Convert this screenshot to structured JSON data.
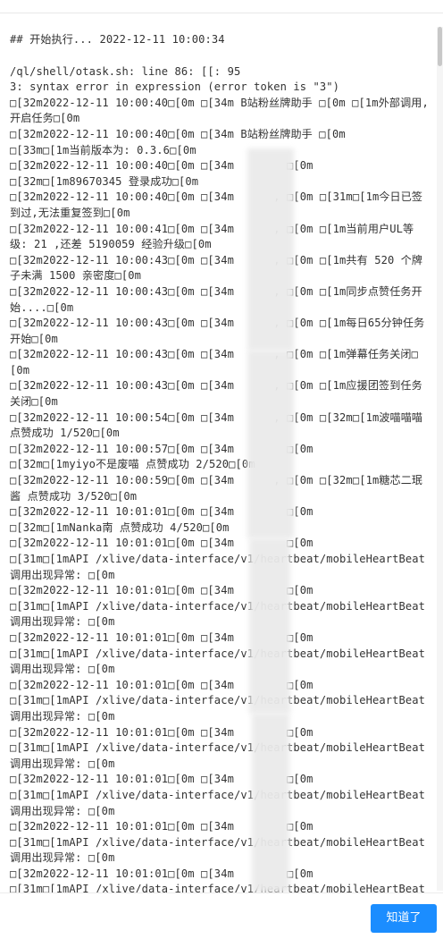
{
  "log": {
    "heading": "## 开始执行... 2022-12-11 10:00:34",
    "lines": [
      "/ql/shell/otask.sh: line 86: [[: 95",
      "3: syntax error in expression (error token is \"3\")",
      "\u001b[32m2022-12-11 10:00:40\u001b[0m \u001b[34m B站粉丝牌助手 \u001b[0m \u001b[1m外部调用,开启任务\u001b[0m",
      "\u001b[32m2022-12-11 10:00:40\u001b[0m \u001b[34m B站粉丝牌助手 \u001b[0m",
      "\u001b[33m\u001b[1m当前版本为: 0.3.6\u001b[0m",
      "\u001b[32m2022-12-11 10:00:40\u001b[0m \u001b[34m        \u001b[0m",
      "\u001b[32m\u001b[1m89670345 登录成功\u001b[0m",
      "\u001b[32m2022-12-11 10:00:40\u001b[0m \u001b[34m      , \u001b[0m \u001b[31m\u001b[1m今日已签到过,无法重复签到\u001b[0m",
      "\u001b[32m2022-12-11 10:00:41\u001b[0m \u001b[34m      , \u001b[0m \u001b[1m当前用户UL等级: 21 ,还差 5190059 经验升级\u001b[0m",
      "\u001b[32m2022-12-11 10:00:43\u001b[0m \u001b[34m      , \u001b[0m \u001b[1m共有 520 个牌子未满 1500 亲密度\u001b[0m",
      "\u001b[32m2022-12-11 10:00:43\u001b[0m \u001b[34m      , \u001b[0m \u001b[1m同步点赞任务开始....\u001b[0m",
      "\u001b[32m2022-12-11 10:00:43\u001b[0m \u001b[34m      , \u001b[0m \u001b[1m每日65分钟任务开始\u001b[0m",
      "\u001b[32m2022-12-11 10:00:43\u001b[0m \u001b[34m      , \u001b[0m \u001b[1m弹幕任务关闭\u001b[0m",
      "\u001b[32m2022-12-11 10:00:43\u001b[0m \u001b[34m      , \u001b[0m \u001b[1m应援团签到任务关闭\u001b[0m",
      "\u001b[32m2022-12-11 10:00:54\u001b[0m \u001b[34m      , \u001b[0m \u001b[32m\u001b[1m波喵喵喵 点赞成功 1/520\u001b[0m",
      "\u001b[32m2022-12-11 10:00:57\u001b[0m \u001b[34m        \u001b[0m",
      "\u001b[32m\u001b[1myiyo不是废喵 点赞成功 2/520\u001b[0m",
      "\u001b[32m2022-12-11 10:00:59\u001b[0m \u001b[34m      , \u001b[0m \u001b[32m\u001b[1m糖芯二珉酱 点赞成功 3/520\u001b[0m",
      "\u001b[32m2022-12-11 10:01:01\u001b[0m \u001b[34m        \u001b[0m",
      "\u001b[32m\u001b[1mNanka南 点赞成功 4/520\u001b[0m",
      "\u001b[32m2022-12-11 10:01:01\u001b[0m \u001b[34m        \u001b[0m",
      "\u001b[31m\u001b[1mAPI /xlive/data-interface/v1/heartbeat/mobileHeartBeat调用出现异常: \u001b[0m",
      "\u001b[32m2022-12-11 10:01:01\u001b[0m \u001b[34m        \u001b[0m",
      "\u001b[31m\u001b[1mAPI /xlive/data-interface/v1/heartbeat/mobileHeartBeat调用出现异常: \u001b[0m",
      "\u001b[32m2022-12-11 10:01:01\u001b[0m \u001b[34m        \u001b[0m",
      "\u001b[31m\u001b[1mAPI /xlive/data-interface/v1/heartbeat/mobileHeartBeat调用出现异常: \u001b[0m",
      "\u001b[32m2022-12-11 10:01:01\u001b[0m \u001b[34m        \u001b[0m",
      "\u001b[31m\u001b[1mAPI /xlive/data-interface/v1/heartbeat/mobileHeartBeat调用出现异常: \u001b[0m",
      "\u001b[32m2022-12-11 10:01:01\u001b[0m \u001b[34m        \u001b[0m",
      "\u001b[31m\u001b[1mAPI /xlive/data-interface/v1/heartbeat/mobileHeartBeat调用出现异常: \u001b[0m",
      "\u001b[32m2022-12-11 10:01:01\u001b[0m \u001b[34m        \u001b[0m",
      "\u001b[31m\u001b[1mAPI /xlive/data-interface/v1/heartbeat/mobileHeartBeat调用出现异常: \u001b[0m",
      "\u001b[32m2022-12-11 10:01:01\u001b[0m \u001b[34m        \u001b[0m",
      "\u001b[31m\u001b[1mAPI /xlive/data-interface/v1/heartbeat/mobileHeartBeat调用出现异常: \u001b[0m",
      "\u001b[32m2022-12-11 10:01:01\u001b[0m \u001b[34m        \u001b[0m",
      "\u001b[31m\u001b[1mAPI /xlive/data-interface/v1/heartbeat/mobileHeartBeat调用出现异常: \u001b[0m",
      "\u001b[32m2022-12-11 10:01:01\u001b[0m \u001b[34m        \u001b[0m"
    ]
  },
  "footer": {
    "ok_label": "知道了"
  },
  "colors": {
    "primary_button": "#1b8dff",
    "log_text": "#333333"
  }
}
